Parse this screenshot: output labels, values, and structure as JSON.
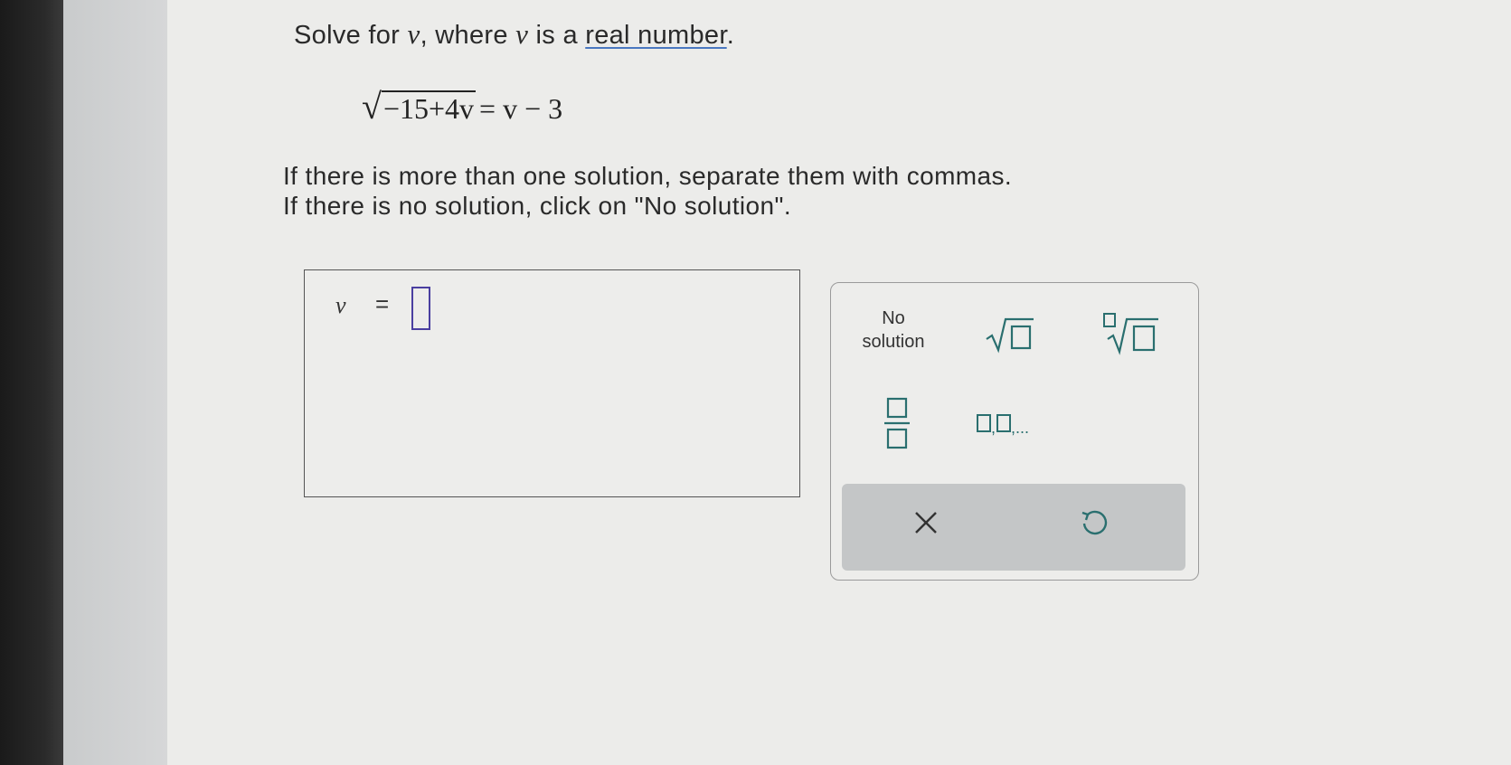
{
  "question": {
    "prompt_before_var": "Solve for ",
    "variable": "v",
    "prompt_middle": ", where ",
    "variable2": "v",
    "prompt_after_var": " is a ",
    "link_text": "real number",
    "prompt_end": ".",
    "equation": {
      "radicand": "−15+4v",
      "right_side": "= v − 3"
    },
    "instructions": [
      "If there is more than one solution, separate them with commas.",
      "If there is no solution, click on \"No solution\"."
    ]
  },
  "answer": {
    "variable_label": "v",
    "equals": "=",
    "value": ""
  },
  "keypad": {
    "no_solution_line1": "No",
    "no_solution_line2": "solution",
    "buttons": [
      "square-root",
      "nth-root",
      "fraction",
      "list"
    ],
    "list_label": "□,□,...",
    "clear_label": "×",
    "undo_label": "↺"
  },
  "colors": {
    "key_icon": "#2a6f6f",
    "input_border": "#4a3fa0",
    "keypad_bar": "#c4c6c7"
  }
}
